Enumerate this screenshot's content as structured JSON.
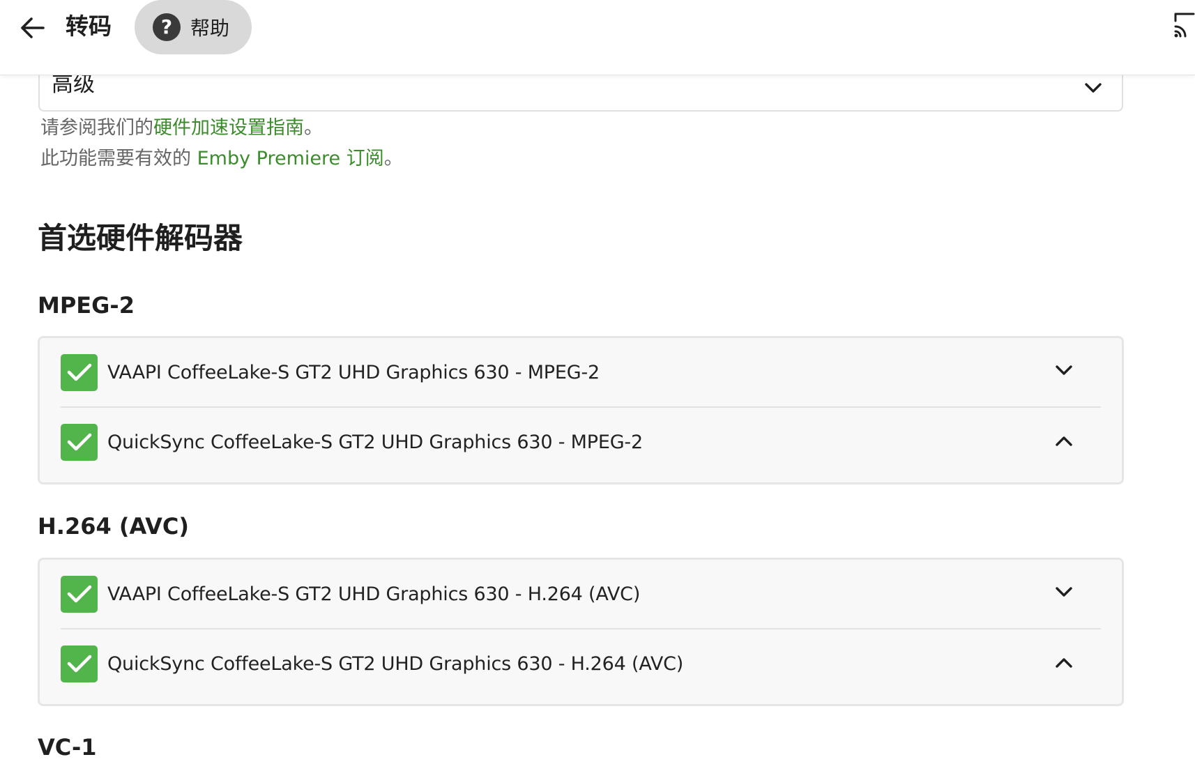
{
  "header": {
    "title": "转码",
    "help_label": "帮助",
    "help_symbol": "?"
  },
  "select": {
    "value": "高级"
  },
  "notes": {
    "line1_prefix": "请参阅我们的",
    "line1_link": "硬件加速设置指南",
    "line1_suffix": "。",
    "line2_prefix": "此功能需要有效的 ",
    "line2_link": "Emby Premiere 订阅",
    "line2_suffix": "。"
  },
  "section": {
    "title": "首选硬件解码器"
  },
  "codecs": [
    {
      "heading": "MPEG-2",
      "items": [
        {
          "label": "VAAPI CoffeeLake-S GT2 UHD Graphics 630 - MPEG-2",
          "checked": true,
          "arrow": "down"
        },
        {
          "label": "QuickSync CoffeeLake-S GT2 UHD Graphics 630 - MPEG-2",
          "checked": true,
          "arrow": "up"
        }
      ]
    },
    {
      "heading": "H.264 (AVC)",
      "items": [
        {
          "label": "VAAPI CoffeeLake-S GT2 UHD Graphics 630 - H.264 (AVC)",
          "checked": true,
          "arrow": "down"
        },
        {
          "label": "QuickSync CoffeeLake-S GT2 UHD Graphics 630 - H.264 (AVC)",
          "checked": true,
          "arrow": "up"
        }
      ]
    },
    {
      "heading": "VC-1"
    }
  ],
  "colors": {
    "accent_green": "#52b54b",
    "link_green": "#3a8d2a"
  }
}
